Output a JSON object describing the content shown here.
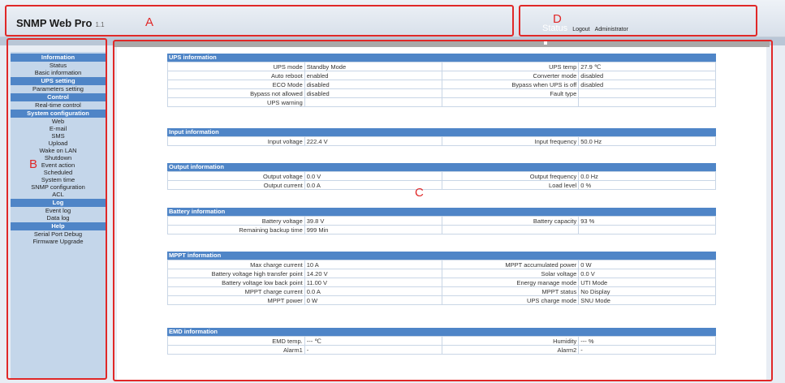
{
  "header": {
    "title": "SNMP Web Pro",
    "version": "1.1",
    "status_label": "Status",
    "logout_label": "Logout",
    "user_label": "Administrator"
  },
  "annotations": {
    "a": "A",
    "b": "B",
    "c": "C",
    "d": "D"
  },
  "sidebar": {
    "sections": [
      {
        "title": "Information",
        "items": [
          "Status",
          "Basic information"
        ]
      },
      {
        "title": "UPS setting",
        "items": [
          "Parameters setting"
        ]
      },
      {
        "title": "Control",
        "items": [
          "Real-time control"
        ]
      },
      {
        "title": "System configuration",
        "items": [
          "Web",
          "E-mail",
          "SMS",
          "Upload",
          "Wake on LAN",
          "Shutdown",
          "Event action",
          "Scheduled",
          "System time",
          "SNMP configuration",
          "ACL"
        ]
      },
      {
        "title": "Log",
        "items": [
          "Event log",
          "Data log"
        ]
      },
      {
        "title": "Help",
        "items": [
          "Serial Port Debug",
          "Firmware Upgrade"
        ]
      }
    ]
  },
  "panels": [
    {
      "title": "UPS information",
      "rows": [
        [
          [
            "UPS mode",
            "Standby Mode"
          ],
          [
            "UPS temp",
            "27.9 ℃"
          ]
        ],
        [
          [
            "Auto reboot",
            "enabled"
          ],
          [
            "Converter mode",
            "disabled"
          ]
        ],
        [
          [
            "ECO Mode",
            "disabled"
          ],
          [
            "Bypass when UPS is off",
            "disabled"
          ]
        ],
        [
          [
            "Bypass not allowed",
            "disabled"
          ],
          [
            "Fault type",
            ""
          ]
        ],
        [
          [
            "UPS warning",
            ""
          ],
          [
            "",
            ""
          ]
        ]
      ]
    },
    {
      "title": "Input information",
      "rows": [
        [
          [
            "Input voltage",
            "222.4 V"
          ],
          [
            "Input frequency",
            "50.0 Hz"
          ]
        ]
      ]
    },
    {
      "title": "Output information",
      "rows": [
        [
          [
            "Output voltage",
            "0.0 V"
          ],
          [
            "Output frequency",
            "0.0 Hz"
          ]
        ],
        [
          [
            "Output current",
            "0.0 A"
          ],
          [
            "Load level",
            "0 %"
          ]
        ]
      ]
    },
    {
      "title": "Battery information",
      "rows": [
        [
          [
            "Battery voltage",
            "39.8 V"
          ],
          [
            "Battery capacity",
            "93 %"
          ]
        ],
        [
          [
            "Remaining backup time",
            "999 Min"
          ],
          [
            "",
            ""
          ]
        ]
      ]
    },
    {
      "title": "MPPT information",
      "rows": [
        [
          [
            "Max charge current",
            "10 A"
          ],
          [
            "MPPT accumulated power",
            "0 W"
          ]
        ],
        [
          [
            "Battery voltage high transfer point",
            "14.20 V"
          ],
          [
            "Solar voltage",
            "0.0 V"
          ]
        ],
        [
          [
            "Battery voltage low back point",
            "11.00 V"
          ],
          [
            "Energy manage mode",
            "UTI Mode"
          ]
        ],
        [
          [
            "MPPT charge current",
            "0.0 A"
          ],
          [
            "MPPT status",
            "No Display"
          ]
        ],
        [
          [
            "MPPT power",
            "0 W"
          ],
          [
            "UPS charge mode",
            "SNU Mode"
          ]
        ]
      ]
    },
    {
      "title": "EMD information",
      "rows": [
        [
          [
            "EMD temp.",
            "--- ℃"
          ],
          [
            "Humidity",
            "--- %"
          ]
        ],
        [
          [
            "Alarm1",
            "-"
          ],
          [
            "Alarm2",
            "-"
          ]
        ]
      ]
    }
  ]
}
